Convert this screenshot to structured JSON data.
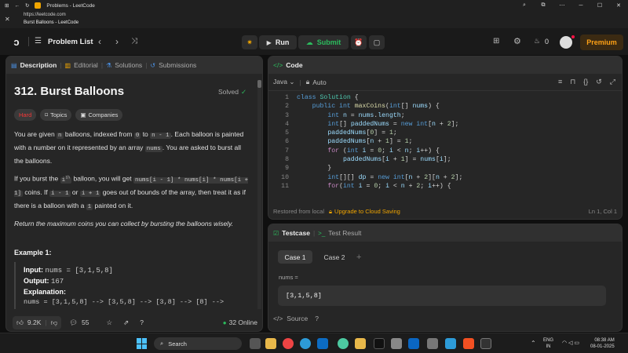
{
  "browser": {
    "tab_title": "Problems - LeetCode",
    "url": "https://leetcode.com",
    "page_title": "Burst Balloons - LeetCode"
  },
  "nav": {
    "problem_list": "Problem List",
    "run": "Run",
    "submit": "Submit",
    "count": "0",
    "premium": "Premium"
  },
  "left": {
    "tabs": [
      "Description",
      "Editorial",
      "Solutions",
      "Submissions"
    ],
    "title": "312. Burst Balloons",
    "status": "Solved",
    "difficulty": "Hard",
    "tags": [
      "Topics",
      "Companies"
    ],
    "p1": [
      "You are given ",
      "n",
      " balloons, indexed from ",
      "0",
      " to ",
      "n - 1",
      ". Each balloon is painted with a number on it represented by an array ",
      "nums",
      ". You are asked to burst all the balloons."
    ],
    "p2": [
      "If you burst the ",
      "i",
      "th",
      " balloon, you will get ",
      "nums[i - 1] * nums[i] * nums[i + 1]",
      " coins. If ",
      "i - 1",
      " or ",
      "i + 1",
      " goes out of bounds of the array, then treat it as if there is a balloon with a ",
      "1",
      " painted on it."
    ],
    "p3": "Return the maximum coins you can collect by bursting the balloons wisely.",
    "example_title": "Example 1:",
    "ex_input_label": "Input:",
    "ex_input": "nums = [3,1,5,8]",
    "ex_output_label": "Output:",
    "ex_output": "167",
    "ex_expl_label": "Explanation:",
    "ex_expl": "nums = [3,1,5,8] --> [3,5,8] --> [3,8] --> [8] -->",
    "likes": "9.2K",
    "comments": "55",
    "online": "32 Online"
  },
  "code": {
    "title": "Code",
    "language": "Java",
    "mode": "Auto",
    "lines": [
      [
        [
          "kw",
          "class "
        ],
        [
          "ty",
          "Solution "
        ],
        [
          "pl",
          "{"
        ]
      ],
      [
        [
          "pl",
          "    "
        ],
        [
          "kw",
          "public int "
        ],
        [
          "fn",
          "maxCoins"
        ],
        [
          "pl",
          "("
        ],
        [
          "kw",
          "int"
        ],
        [
          "pl",
          "[] "
        ],
        [
          "id",
          "nums"
        ],
        [
          "pl",
          ") {"
        ]
      ],
      [
        [
          "pl",
          "        "
        ],
        [
          "kw",
          "int "
        ],
        [
          "id",
          "n"
        ],
        [
          "pl",
          " = "
        ],
        [
          "id",
          "nums"
        ],
        [
          "pl",
          "."
        ],
        [
          "id",
          "length"
        ],
        [
          "pl",
          ";"
        ]
      ],
      [
        [
          "pl",
          "        "
        ],
        [
          "kw",
          "int"
        ],
        [
          "pl",
          "[] "
        ],
        [
          "id",
          "paddedNums"
        ],
        [
          "pl",
          " = "
        ],
        [
          "kw",
          "new int"
        ],
        [
          "pl",
          "["
        ],
        [
          "id",
          "n"
        ],
        [
          "pl",
          " + "
        ],
        [
          "nu",
          "2"
        ],
        [
          "pl",
          "];"
        ]
      ],
      [
        [
          "pl",
          "        "
        ],
        [
          "id",
          "paddedNums"
        ],
        [
          "pl",
          "["
        ],
        [
          "nu",
          "0"
        ],
        [
          "pl",
          "] = "
        ],
        [
          "nu",
          "1"
        ],
        [
          "pl",
          ";"
        ]
      ],
      [
        [
          "pl",
          "        "
        ],
        [
          "id",
          "paddedNums"
        ],
        [
          "pl",
          "["
        ],
        [
          "id",
          "n"
        ],
        [
          "pl",
          " + "
        ],
        [
          "nu",
          "1"
        ],
        [
          "pl",
          "] = "
        ],
        [
          "nu",
          "1"
        ],
        [
          "pl",
          ";"
        ]
      ],
      [
        [
          "pl",
          "        "
        ],
        [
          "cf",
          "for "
        ],
        [
          "pl",
          "("
        ],
        [
          "kw",
          "int "
        ],
        [
          "id",
          "i"
        ],
        [
          "pl",
          " = "
        ],
        [
          "nu",
          "0"
        ],
        [
          "pl",
          "; "
        ],
        [
          "id",
          "i"
        ],
        [
          "pl",
          " < "
        ],
        [
          "id",
          "n"
        ],
        [
          "pl",
          "; "
        ],
        [
          "id",
          "i"
        ],
        [
          "pl",
          "++) {"
        ]
      ],
      [
        [
          "pl",
          "            "
        ],
        [
          "id",
          "paddedNums"
        ],
        [
          "pl",
          "["
        ],
        [
          "id",
          "i"
        ],
        [
          "pl",
          " + "
        ],
        [
          "nu",
          "1"
        ],
        [
          "pl",
          "] = "
        ],
        [
          "id",
          "nums"
        ],
        [
          "pl",
          "["
        ],
        [
          "id",
          "i"
        ],
        [
          "pl",
          "];"
        ]
      ],
      [
        [
          "pl",
          "        }"
        ]
      ],
      [
        [
          "pl",
          "        "
        ],
        [
          "kw",
          "int"
        ],
        [
          "pl",
          "[][] "
        ],
        [
          "id",
          "dp"
        ],
        [
          "pl",
          " = "
        ],
        [
          "kw",
          "new int"
        ],
        [
          "pl",
          "["
        ],
        [
          "id",
          "n"
        ],
        [
          "pl",
          " + "
        ],
        [
          "nu",
          "2"
        ],
        [
          "pl",
          "]["
        ],
        [
          "id",
          "n"
        ],
        [
          "pl",
          " + "
        ],
        [
          "nu",
          "2"
        ],
        [
          "pl",
          "];"
        ]
      ],
      [
        [
          "pl",
          "        "
        ],
        [
          "cf",
          "for"
        ],
        [
          "pl",
          "("
        ],
        [
          "kw",
          "int "
        ],
        [
          "id",
          "i"
        ],
        [
          "pl",
          " = "
        ],
        [
          "nu",
          "0"
        ],
        [
          "pl",
          "; "
        ],
        [
          "id",
          "i"
        ],
        [
          "pl",
          " < "
        ],
        [
          "id",
          "n"
        ],
        [
          "pl",
          " + "
        ],
        [
          "nu",
          "2"
        ],
        [
          "pl",
          "; "
        ],
        [
          "id",
          "i"
        ],
        [
          "pl",
          "++) {"
        ]
      ]
    ],
    "restored": "Restored from local",
    "upgrade": "Upgrade to Cloud Saving",
    "position": "Ln 1, Col 1"
  },
  "testcase": {
    "tab1": "Testcase",
    "tab2": "Test Result",
    "case1": "Case 1",
    "case2": "Case 2",
    "label": "nums =",
    "value": "[3,1,5,8]",
    "source": "Source"
  },
  "taskbar": {
    "search": "Search",
    "lang1": "ENG",
    "lang2": "IN",
    "time": "08:38 AM",
    "date": "08-01-2025"
  }
}
